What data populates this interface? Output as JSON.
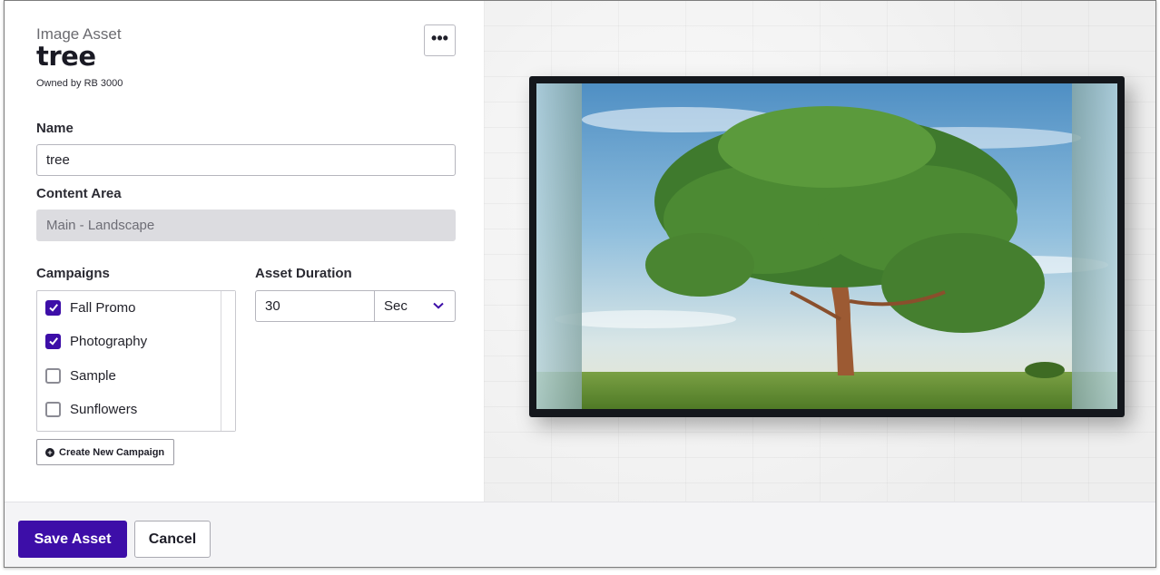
{
  "header": {
    "kicker": "Image Asset",
    "title": "tree",
    "owner": "Owned by RB 3000",
    "more_icon": "ellipsis-icon"
  },
  "form": {
    "name_label": "Name",
    "name_value": "tree",
    "content_area_label": "Content Area",
    "content_area_value": "Main - Landscape",
    "campaigns_label": "Campaigns",
    "campaigns": [
      {
        "label": "Fall Promo",
        "checked": true
      },
      {
        "label": "Photography",
        "checked": true
      },
      {
        "label": "Sample",
        "checked": false
      },
      {
        "label": "Sunflowers",
        "checked": false
      }
    ],
    "create_campaign_label": "Create New Campaign",
    "duration_label": "Asset Duration",
    "duration_value": "30",
    "duration_unit": "Sec"
  },
  "footer": {
    "save_label": "Save Asset",
    "cancel_label": "Cancel"
  },
  "colors": {
    "accent": "#3d0ea8",
    "disabled_bg": "#dcdce0"
  }
}
